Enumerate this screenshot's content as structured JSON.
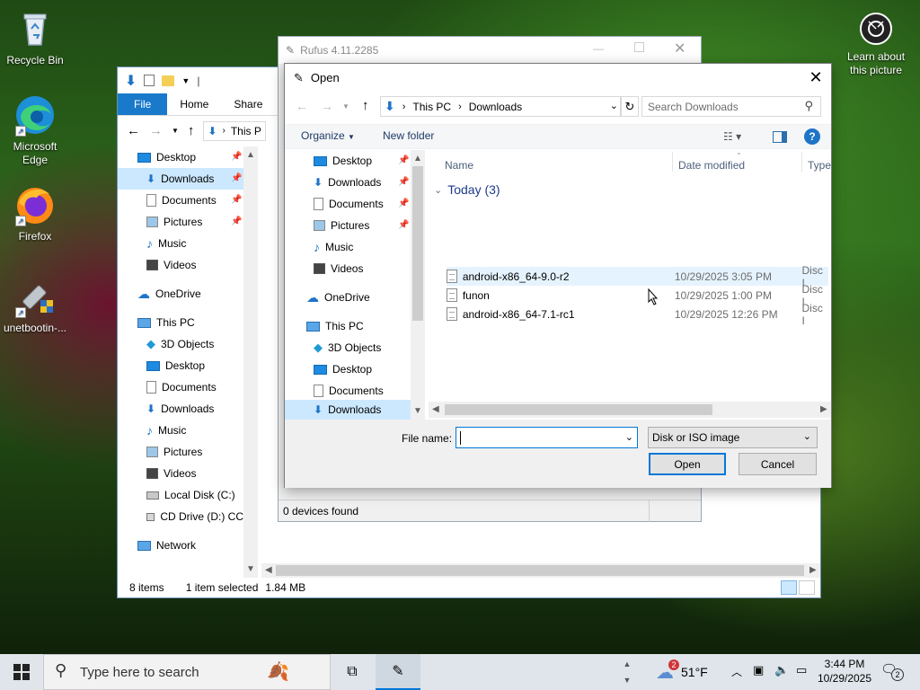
{
  "desktop": {
    "icons": [
      {
        "label": "Recycle Bin",
        "icon": "recycle-bin-icon"
      },
      {
        "label": "Microsoft Edge",
        "icon": "edge-icon"
      },
      {
        "label": "Firefox",
        "icon": "firefox-icon"
      },
      {
        "label": "unetbootin-...",
        "icon": "unetbootin-icon"
      }
    ],
    "learn": {
      "label": "Learn about this picture",
      "icon": "camera-icon"
    }
  },
  "explorer": {
    "title_partial": "|",
    "tabs": [
      "File",
      "Home",
      "Share"
    ],
    "address_partial": "This P",
    "nav": [
      {
        "label": "Desktop",
        "pinned": true
      },
      {
        "label": "Downloads",
        "pinned": true,
        "selected": true
      },
      {
        "label": "Documents",
        "pinned": true
      },
      {
        "label": "Pictures",
        "pinned": true
      },
      {
        "label": "Music"
      },
      {
        "label": "Videos"
      },
      {
        "label": "OneDrive"
      },
      {
        "label": "This PC"
      },
      {
        "label": "3D Objects"
      },
      {
        "label": "Desktop"
      },
      {
        "label": "Documents"
      },
      {
        "label": "Downloads"
      },
      {
        "label": "Music"
      },
      {
        "label": "Pictures"
      },
      {
        "label": "Videos"
      },
      {
        "label": "Local Disk (C:)"
      },
      {
        "label": "CD Drive (D:) CC"
      },
      {
        "label": "Network"
      }
    ],
    "status": {
      "items": "8 items",
      "selected": "1 item selected",
      "size": "1.84 MB"
    }
  },
  "rufus": {
    "title": "Rufus 4.11.2285",
    "status": "0 devices found"
  },
  "dialog": {
    "title": "Open",
    "breadcrumb": [
      "This PC",
      "Downloads"
    ],
    "search_placeholder": "Search Downloads",
    "toolbar": {
      "organize": "Organize",
      "new_folder": "New folder"
    },
    "nav": [
      {
        "label": "Desktop",
        "pinned": true
      },
      {
        "label": "Downloads",
        "pinned": true
      },
      {
        "label": "Documents",
        "pinned": true
      },
      {
        "label": "Pictures",
        "pinned": true
      },
      {
        "label": "Music"
      },
      {
        "label": "Videos"
      },
      {
        "label": "OneDrive"
      },
      {
        "label": "This PC"
      },
      {
        "label": "3D Objects"
      },
      {
        "label": "Desktop"
      },
      {
        "label": "Documents"
      },
      {
        "label": "Downloads",
        "selected": true
      }
    ],
    "columns": {
      "name": "Name",
      "date": "Date modified",
      "type": "Type"
    },
    "group": "Today (3)",
    "files": [
      {
        "name": "android-x86_64-9.0-r2",
        "date": "10/29/2025 3:05 PM",
        "type": "Disc I"
      },
      {
        "name": "funon",
        "date": "10/29/2025 1:00 PM",
        "type": "Disc I"
      },
      {
        "name": "android-x86_64-7.1-rc1",
        "date": "10/29/2025 12:26 PM",
        "type": "Disc I"
      }
    ],
    "file_name_label": "File name:",
    "file_name_value": "",
    "file_type": "Disk or ISO image",
    "open_label": "Open",
    "cancel_label": "Cancel"
  },
  "taskbar": {
    "search_placeholder": "Type here to search",
    "weather_badge": "2",
    "temperature": "51°F",
    "time": "3:44 PM",
    "date": "10/29/2025",
    "notification_count": "2"
  },
  "colors": {
    "accent": "#0078d7",
    "file_tab": "#1979ca",
    "selection": "#cce8ff",
    "folder_blue": "#1e74c7"
  }
}
